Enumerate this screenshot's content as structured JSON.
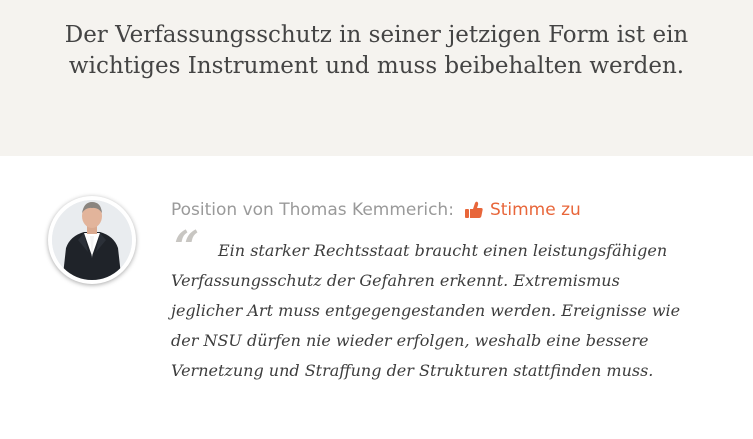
{
  "thesis": {
    "line1": "Der Verfassungsschutz in seiner jetzigen Form ist ein",
    "line2": "wichtiges Instrument und muss beibehalten werden."
  },
  "position": {
    "label": "Position von Thomas Kemmerich:",
    "verdict": "Stimme zu",
    "verdict_icon": "thumbs-up-icon",
    "accent_color": "#e8663a"
  },
  "quote": {
    "mark": "“",
    "text": "Ein starker Rechtsstaat braucht einen leistungsfähigen Verfassungsschutz der Gefahren erkennt. Extremismus jeglicher Art muss entgegengestanden werden. Ereignisse wie der NSU dürfen nie wieder erfolgen, weshalb eine bessere Vernetzung und Straffung der Strukturen stattfinden muss."
  },
  "colors": {
    "thesis_background": "#f5f3ef",
    "label_grey": "#9a9a9a",
    "text_dark": "#3d3d3d"
  }
}
